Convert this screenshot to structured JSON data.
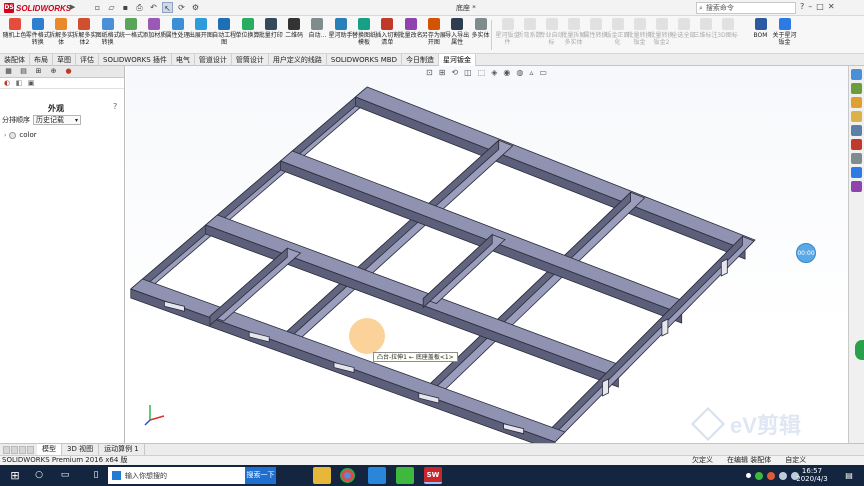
{
  "app": {
    "brand": "SOLIDWORKS",
    "doc_title": "底座 *",
    "search_placeholder": "搜索命令",
    "quick_icons": [
      "new-icon",
      "open-icon",
      "save-icon",
      "print-icon",
      "undo-icon",
      "select-icon",
      "rebuild-icon",
      "options-icon"
    ]
  },
  "ribbon": {
    "active": [
      {
        "label": "随机上色",
        "color": "#e44d3c"
      },
      {
        "label": "零件格式转换",
        "color": "#2f7fd1"
      },
      {
        "label": "拆解多实体",
        "color": "#e98a2a"
      },
      {
        "label": "拆解多实体2",
        "color": "#d14f2f"
      },
      {
        "label": "图纸格式转换",
        "color": "#4a90d9"
      },
      {
        "label": "统一格式",
        "color": "#5aa55a"
      },
      {
        "label": "添加材质",
        "color": "#9b59b6"
      },
      {
        "label": "属性处理",
        "color": "#3a8fd6"
      },
      {
        "label": "出展开图",
        "color": "#2d9cdb"
      },
      {
        "label": "自动工程图",
        "color": "#1f6fb5"
      },
      {
        "label": "单位换算",
        "color": "#27ae60"
      },
      {
        "label": "批量打印",
        "color": "#34495e"
      },
      {
        "label": "二维码",
        "color": "#333333"
      },
      {
        "label": "自动...",
        "color": "#7f8c8d"
      },
      {
        "label": "星河助手",
        "color": "#2980b9"
      },
      {
        "label": "替换图纸模板",
        "color": "#16a085"
      },
      {
        "label": "插入切割清单",
        "color": "#c0392b"
      },
      {
        "label": "批量改名",
        "color": "#8e44ad"
      },
      {
        "label": "另存为展开图",
        "color": "#d35400"
      },
      {
        "label": "导入导出属性",
        "color": "#2c3e50"
      },
      {
        "label": "多实体",
        "color": "#7f8c8d"
      }
    ],
    "dim": [
      "星河钣金件",
      "折弯系数",
      "专业自动标",
      "批量拆解多实体",
      "属性转换",
      "钣金正面化",
      "批量转换钣金",
      "批量转换钣金2",
      "全选全部",
      "三维标注",
      "3D图标"
    ],
    "right": [
      {
        "label": "BOM",
        "color": "#2c5aa0"
      },
      {
        "label": "关于星河钣金",
        "color": "#2c7be5"
      }
    ]
  },
  "tabs": [
    "装配体",
    "布局",
    "草图",
    "评估",
    "SOLIDWORKS 插件",
    "电气",
    "管道设计",
    "管筒设计",
    "用户定义的线路",
    "SOLIDWORKS MBD",
    "今日制造",
    "星河钣金"
  ],
  "active_tab_index": 11,
  "left_panel": {
    "title": "外观",
    "help": "?",
    "sort_label": "分排顺序",
    "sort_value": "历史记载",
    "tree_items": [
      {
        "label": "color"
      }
    ]
  },
  "viewport": {
    "tooltip": "凸台-拉伸1 ← 底座盖板<1>",
    "timer": "00:00",
    "watermark": "eV剪辑",
    "heads_up_icons": [
      "zoom-fit-icon",
      "zoom-area-icon",
      "previous-view-icon",
      "section-view-icon",
      "view-orientation-icon",
      "display-style-icon",
      "hide-show-icon",
      "edit-appearance-icon",
      "scene-icon",
      "view-settings-icon"
    ]
  },
  "model_tabs": [
    "模型",
    "3D 视图",
    "运动算例 1"
  ],
  "status": {
    "left": "SOLIDWORKS Premium 2016 x64 版",
    "undefined": "欠定义",
    "editing": "在编辑 装配体",
    "custom": "自定义"
  },
  "taskbar": {
    "search_placeholder": "输入你想搜的",
    "search_button": "搜索一下",
    "time": "16:57",
    "date": "2020/4/3"
  }
}
